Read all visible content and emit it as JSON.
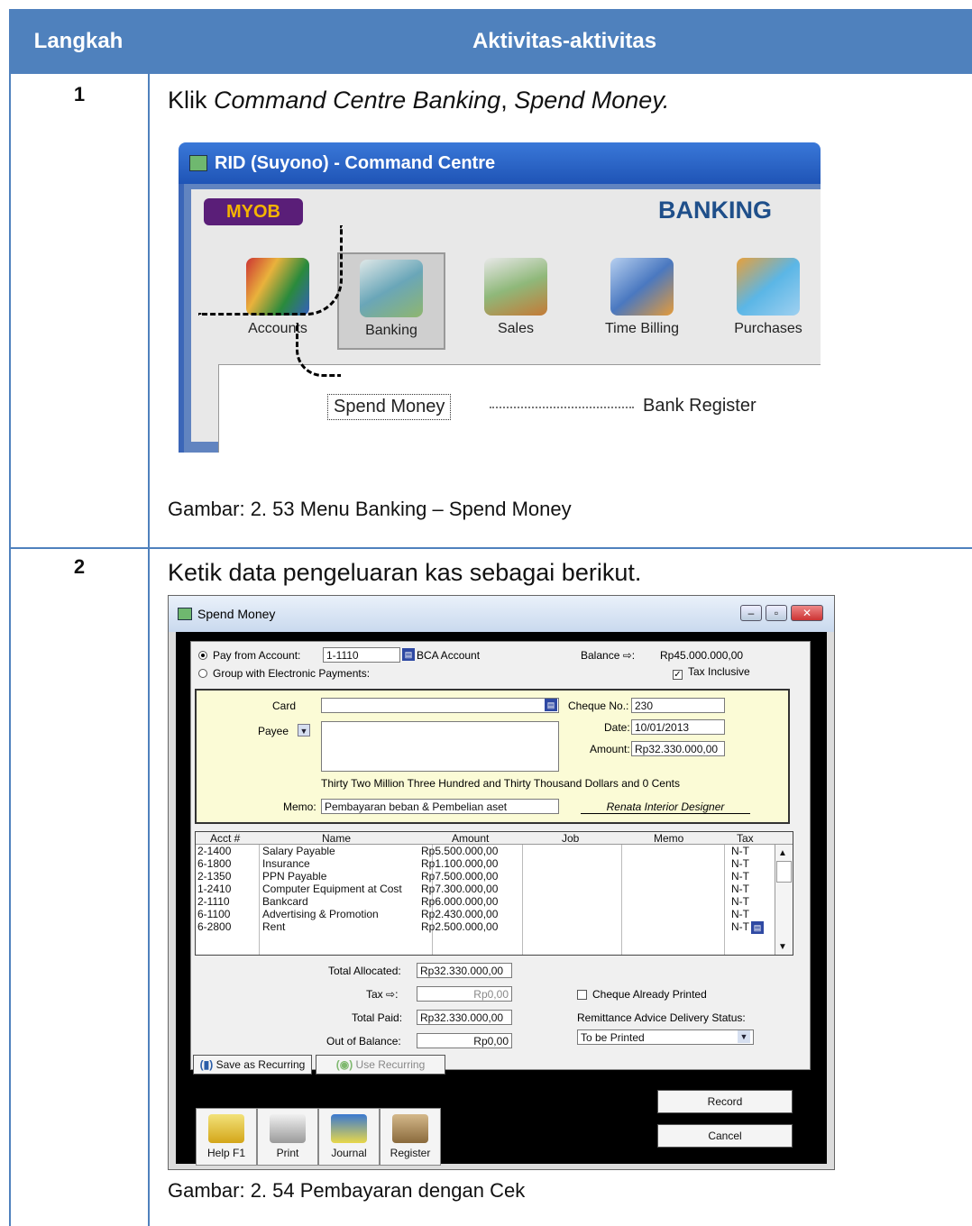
{
  "table": {
    "col1": "Langkah",
    "col2": "Aktivitas-aktivitas"
  },
  "step1": {
    "num": "1",
    "instr_prefix": "Klik ",
    "instr_i1": "Command Centre Banking",
    "instr_mid": ", ",
    "instr_i2": "Spend Money.",
    "caption": "Gambar: 2. 53 Menu Banking – Spend Money",
    "window": {
      "title": "RID (Suyono) - Command Centre",
      "logo": "MYOB",
      "section": "BANKING",
      "modules": [
        "Accounts",
        "Banking",
        "Sales",
        "Time Billing",
        "Purchases"
      ],
      "links": {
        "spend": "Spend Money",
        "register": "Bank Register"
      }
    }
  },
  "step2": {
    "num": "2",
    "instr": "Ketik data pengeluaran kas sebagai berikut.",
    "caption": "Gambar: 2. 54 Pembayaran dengan Cek",
    "window": {
      "title": "Spend Money",
      "pay_from_label": "Pay from Account:",
      "account_no": "1-1110",
      "account_name": "BCA Account",
      "balance_label": "Balance ⇨:",
      "balance": "Rp45.000.000,00",
      "tax_inclusive": "Tax Inclusive",
      "group_label": "Group with Electronic Payments:",
      "card_label": "Card",
      "payee_label": "Payee",
      "cheque_label": "Cheque No.:",
      "cheque_no": "230",
      "date_label": "Date:",
      "date": "10/01/2013",
      "amount_label": "Amount:",
      "amount": "Rp32.330.000,00",
      "amount_words": "Thirty Two Million Three Hundred and Thirty Thousand Dollars and 0 Cents",
      "memo_label": "Memo:",
      "memo": "Pembayaran beban & Pembelian aset",
      "company": "Renata Interior Designer",
      "columns": [
        "Acct #",
        "Name",
        "Amount",
        "Job",
        "Memo",
        "Tax"
      ],
      "rows": [
        {
          "acct": "2-1400",
          "name": "Salary Payable",
          "amount": "Rp5.500.000,00",
          "tax": "N-T"
        },
        {
          "acct": "6-1800",
          "name": "Insurance",
          "amount": "Rp1.100.000,00",
          "tax": "N-T"
        },
        {
          "acct": "2-1350",
          "name": "PPN Payable",
          "amount": "Rp7.500.000,00",
          "tax": "N-T"
        },
        {
          "acct": "1-2410",
          "name": "Computer Equipment at Cost",
          "amount": "Rp7.300.000,00",
          "tax": "N-T"
        },
        {
          "acct": "2-1110",
          "name": "Bankcard",
          "amount": "Rp6.000.000,00",
          "tax": "N-T"
        },
        {
          "acct": "6-1100",
          "name": "Advertising & Promotion",
          "amount": "Rp2.430.000,00",
          "tax": "N-T"
        },
        {
          "acct": "6-2800",
          "name": "Rent",
          "amount": "Rp2.500.000,00",
          "tax": "N-T"
        }
      ],
      "total_allocated_label": "Total Allocated:",
      "total_allocated": "Rp32.330.000,00",
      "tax_label": "Tax ⇨:",
      "tax": "Rp0,00",
      "total_paid_label": "Total Paid:",
      "total_paid": "Rp32.330.000,00",
      "oob_label": "Out of Balance:",
      "oob": "Rp0,00",
      "cheque_printed": "Cheque Already Printed",
      "remit_label": "Remittance Advice Delivery Status:",
      "remit": "To be Printed",
      "save_recurring": "Save as Recurring",
      "use_recurring": "Use Recurring",
      "tools": [
        "Help F1",
        "Print",
        "Journal",
        "Register"
      ],
      "record": "Record",
      "cancel": "Cancel"
    }
  }
}
